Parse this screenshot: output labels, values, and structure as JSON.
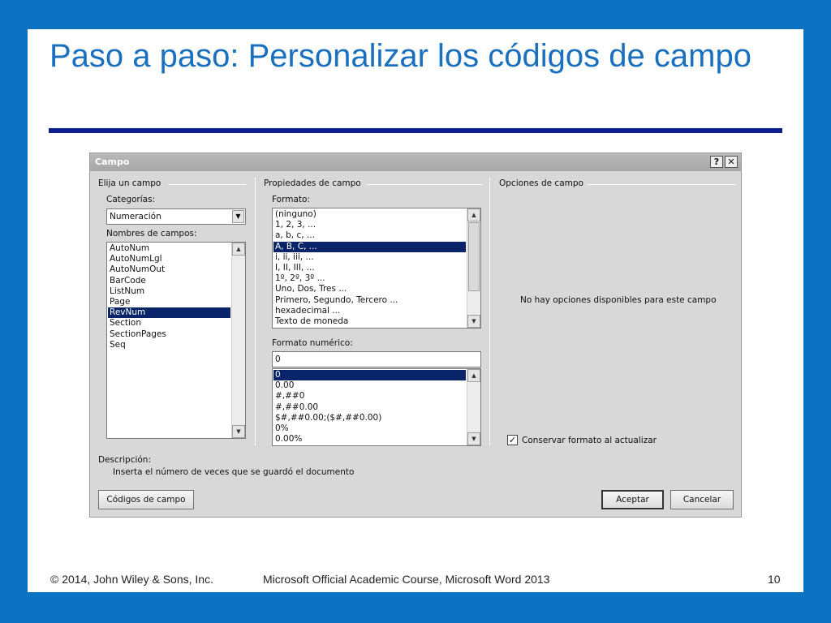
{
  "slide": {
    "title": "Paso a paso: Personalizar los códigos de campo",
    "footer_left": "© 2014, John Wiley & Sons, Inc.",
    "footer_center": "Microsoft Official Academic Course, Microsoft Word 2013",
    "page_number": "10"
  },
  "dialog": {
    "title": "Campo",
    "help_button": "?",
    "close_button": "✕",
    "choose_group": "Elija un campo",
    "categories_label": "Categorías:",
    "categories_value": "Numeración",
    "field_names_label": "Nombres de campos:",
    "field_names": [
      "AutoNum",
      "AutoNumLgl",
      "AutoNumOut",
      "BarCode",
      "ListNum",
      "Page",
      "RevNum",
      "Section",
      "SectionPages",
      "Seq"
    ],
    "field_names_selected": "RevNum",
    "properties_group": "Propiedades de campo",
    "format_label": "Formato:",
    "formats": [
      "(ninguno)",
      "1, 2, 3, ...",
      "a, b, c, ...",
      "A, B, C, ...",
      "i, ii, iii, ...",
      "I, II, III, ...",
      "1º, 2º, 3º ...",
      "Uno, Dos, Tres ...",
      "Primero, Segundo, Tercero ...",
      "hexadecimal ...",
      "Texto de moneda"
    ],
    "formats_selected": "A, B, C, ...",
    "numeric_format_label": "Formato numérico:",
    "numeric_format_value": "0",
    "numeric_formats": [
      "0",
      "0.00",
      "#,##0",
      "#,##0.00",
      "$#,##0.00;($#,##0.00)",
      "0%",
      "0.00%"
    ],
    "numeric_formats_selected": "0",
    "options_group": "Opciones de campo",
    "no_options_text": "No hay opciones disponibles para este campo",
    "preserve_format_label": "Conservar formato al actualizar",
    "preserve_format_checked": true,
    "description_label": "Descripción:",
    "description_text": "Inserta el número de veces que se guardó el documento",
    "field_codes_button": "Códigos de campo",
    "ok_button": "Aceptar",
    "cancel_button": "Cancelar"
  },
  "colors": {
    "background": "#0b73c2",
    "title": "#1a6fbe",
    "rule": "#0d1f8c",
    "selection": "#0a246a"
  }
}
